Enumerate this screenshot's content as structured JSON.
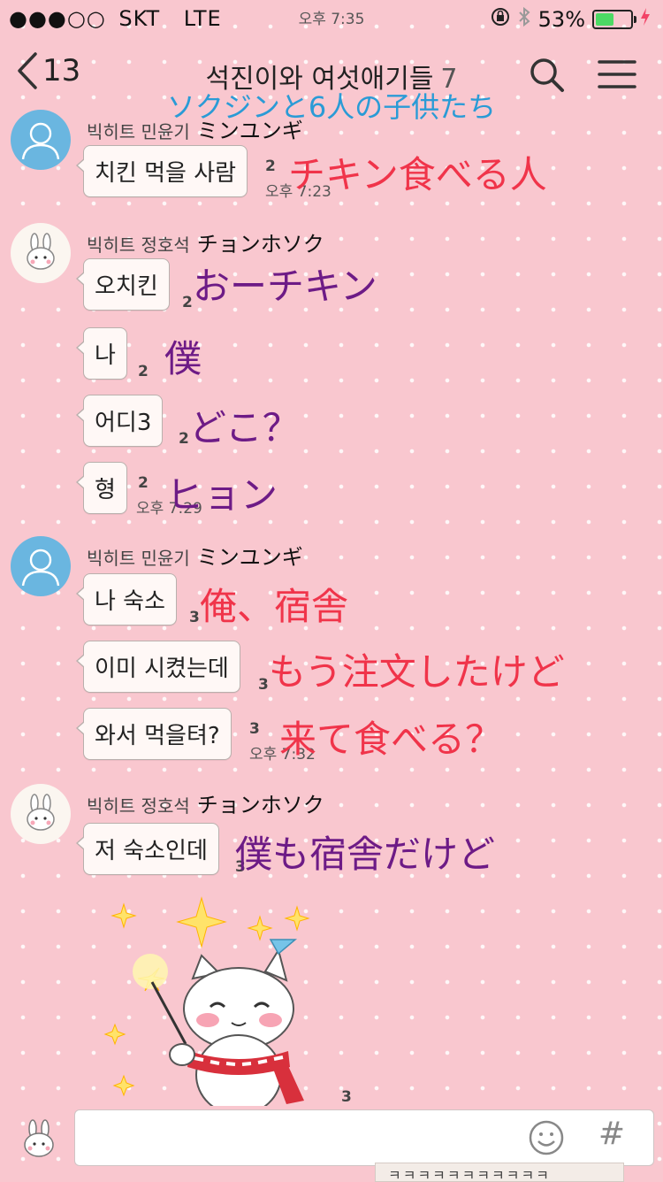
{
  "status": {
    "signal": "●●●○○",
    "carrier": "SKT",
    "network": "LTE",
    "time": "오후 7:35",
    "battery": "53%",
    "battery_level": 0.53
  },
  "nav": {
    "back_count": "13",
    "title": "석진이와 여섯애기들",
    "member_count": "7",
    "title_translation": "ソクジンと6人の子供たち"
  },
  "messages": {
    "g1": {
      "sender": "빅히트 민윤기",
      "sender_ja": "ミンユンギ",
      "b1": "치킨 먹을 사람",
      "b1_unread": "2",
      "b1_time": "오후 7:23",
      "b1_trans": "チキン食べる人"
    },
    "g2": {
      "sender": "빅히트 정호석",
      "sender_ja": "チョンホソク",
      "b1": "오치킨",
      "b1_unread": "2",
      "b1_trans": "おーチキン",
      "b2": "나",
      "b2_unread": "2",
      "b2_trans": "僕",
      "b3": "어디3",
      "b3_unread": "2",
      "b3_trans": "どこ？",
      "b4": "형",
      "b4_unread": "2",
      "b4_time": "오후 7:29",
      "b4_trans": "ヒョン"
    },
    "g3": {
      "sender": "빅히트 민윤기",
      "sender_ja": "ミンユンギ",
      "b1": "나 숙소",
      "b1_unread": "3",
      "b1_trans": "俺、宿舎",
      "b2": "이미 시켰는데",
      "b2_unread": "3",
      "b2_trans": "もう注文したけど",
      "b3": "와서 먹을텨?",
      "b3_unread": "3",
      "b3_time": "오후 7:32",
      "b3_trans": "来て食べる？"
    },
    "g4": {
      "sender": "빅히트 정호석",
      "sender_ja": "チョンホソク",
      "b1": "저 숙소인데",
      "b1_unread": "3",
      "b1_trans": "僕も宿舎だけど",
      "sticker_unread": "3"
    }
  },
  "input": {
    "hash_label": "#",
    "below_preview": "ㅋㅋㅋㅋㅋㅋㅋㅋㅋㅋㅋ"
  },
  "colors": {
    "background": "#f9c7cf",
    "translation_red": "#f0344a",
    "translation_purple": "#6d1b86",
    "translation_blue": "#2a9bd6"
  }
}
